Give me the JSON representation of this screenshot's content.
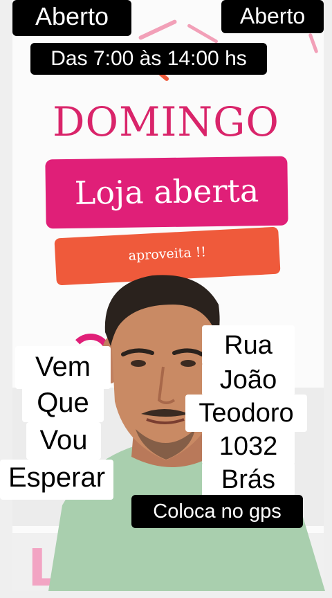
{
  "overlays": {
    "top_left_tag": "Aberto",
    "top_right_tag": "Aberto",
    "hours": "Das 7:00 às 14:00 hs",
    "left_caption": [
      "Vem",
      "Que",
      "Vou",
      "Esperar"
    ],
    "address": [
      "Rua",
      "João",
      "Teodoro",
      "1032",
      "Brás"
    ],
    "gps_caption": "Coloca no gps"
  },
  "poster": {
    "heading": "DOMINGO",
    "banner": "Loja aberta",
    "sub_banner": "aproveita !!"
  },
  "colors": {
    "pink": "#e01f78",
    "heading_pink": "#d9246a",
    "orange": "#ef5a3b",
    "tag_bg": "#000000",
    "tag_text": "#ffffff",
    "shirt": "#a9cfae",
    "skin": "#c98a64"
  }
}
